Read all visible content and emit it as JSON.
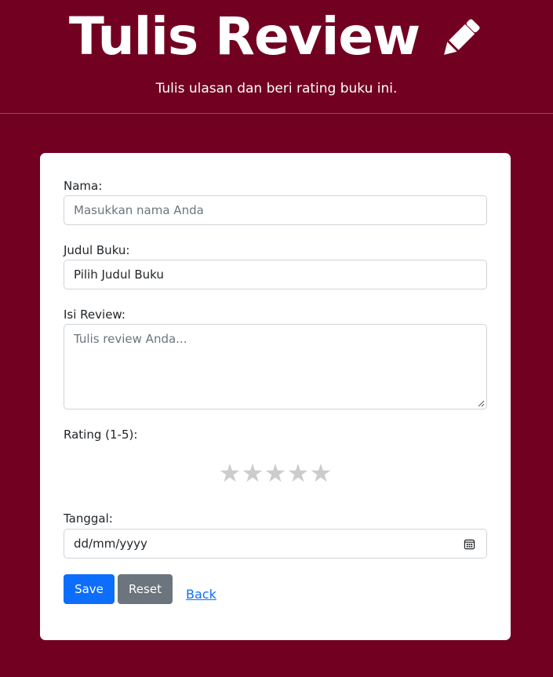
{
  "header": {
    "title": "Tulis Review",
    "title_icon": "pencil-icon",
    "subtitle": "Tulis ulasan dan beri rating buku ini."
  },
  "form": {
    "name": {
      "label": "Nama:",
      "placeholder": "Masukkan nama Anda"
    },
    "book": {
      "label": "Judul Buku:",
      "selected": "Pilih Judul Buku"
    },
    "review": {
      "label": "Isi Review:",
      "placeholder": "Tulis review Anda..."
    },
    "rating": {
      "label": "Rating (1-5):",
      "stars": [
        "★",
        "★",
        "★",
        "★",
        "★"
      ],
      "selected_value": 0,
      "star_color": "#cccccc"
    },
    "date": {
      "label": "Tanggal:",
      "placeholder": "dd/mm/yyyy",
      "icon": "calendar-icon"
    },
    "actions": {
      "save_label": "Save",
      "reset_label": "Reset",
      "back_label": "Back"
    }
  },
  "colors": {
    "background": "#720021",
    "card": "#ffffff",
    "save": "#0d6efd",
    "reset": "#6c757d",
    "link": "#0d6efd"
  }
}
